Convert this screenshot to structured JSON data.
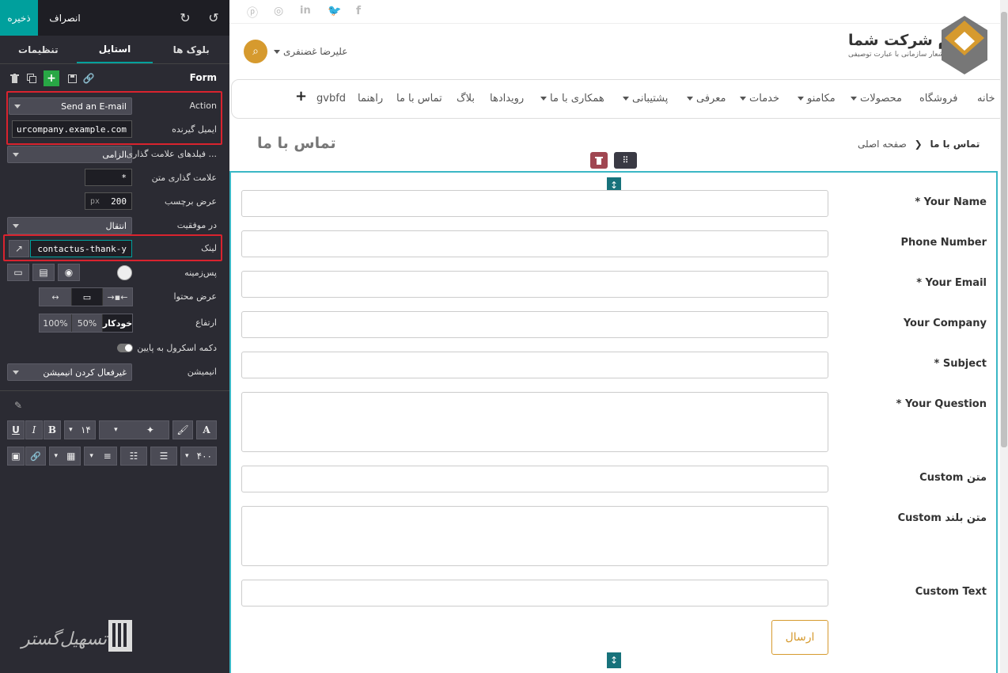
{
  "editor": {
    "save_label": "ذخیره",
    "cancel_label": "انصراف",
    "tabs": [
      "تنظیمات",
      "استایل",
      "بلوک ها"
    ],
    "section_title": "Form",
    "action": {
      "label": "Action",
      "value": "Send an E-mail"
    },
    "recipient": {
      "label": "ایمیل گیرنده",
      "value": "urcompany.example.com"
    },
    "mark_fields": {
      "label": "فیلدهای علامت گذاری ...",
      "value": "الزامی"
    },
    "mark_text": {
      "label": "علامت گذاری متن",
      "value": "*"
    },
    "label_width": {
      "label": "عرض برچسب",
      "value": "200",
      "unit": "px"
    },
    "on_success": {
      "label": "در موفقیت",
      "value": "انتقال"
    },
    "link": {
      "label": "لینک",
      "value": "contactus-thank-y"
    },
    "background": {
      "label": "پس‌زمینه"
    },
    "content_width": {
      "label": "عرض محتوا"
    },
    "height": {
      "label": "ارتفاع",
      "options": [
        "خودکار",
        "50%",
        "100%"
      ]
    },
    "scroll_button": {
      "label": "دکمه اسکرول به پایین"
    },
    "animation": {
      "label": "انیمیشن",
      "value": "غیرفعال کردن انیمیشن"
    },
    "font_size": "۱۴",
    "image_width": "۴۰۰",
    "accent_color": "#00a09d",
    "highlight_color": "#d9232e"
  },
  "site": {
    "company_name": "نام شرکت شما",
    "company_slogan": "شعار سازمانی با عبارت توصیفی",
    "user_name": "علیرضا غضنفری",
    "nav": [
      "خانه",
      "فروشگاه",
      "محصولات",
      "مکامنو",
      "خدمات",
      "معرفی",
      "پشتیبانی",
      "همکاری با ما",
      "رویدادها",
      "بلاگ",
      "تماس با ما",
      "راهنما",
      "gvbfd"
    ],
    "breadcrumb_home": "صفحه اصلی",
    "breadcrumb_current": "تماس با ما",
    "page_title": "تماس با ما",
    "form_fields": [
      {
        "label": "Your Name",
        "required": true
      },
      {
        "label": "Phone Number",
        "required": false
      },
      {
        "label": "Your Email",
        "required": true
      },
      {
        "label": "Your Company",
        "required": false
      },
      {
        "label": "Subject",
        "required": true
      },
      {
        "label": "Your Question",
        "required": true
      },
      {
        "label": "Custom متن",
        "required": false
      },
      {
        "label": "Custom متن بلند",
        "required": false
      },
      {
        "label": "Custom Text",
        "required": false
      }
    ],
    "submit_label": "ارسال",
    "brand_color": "#d69a2e"
  },
  "watermark": "تسهیل گستر"
}
